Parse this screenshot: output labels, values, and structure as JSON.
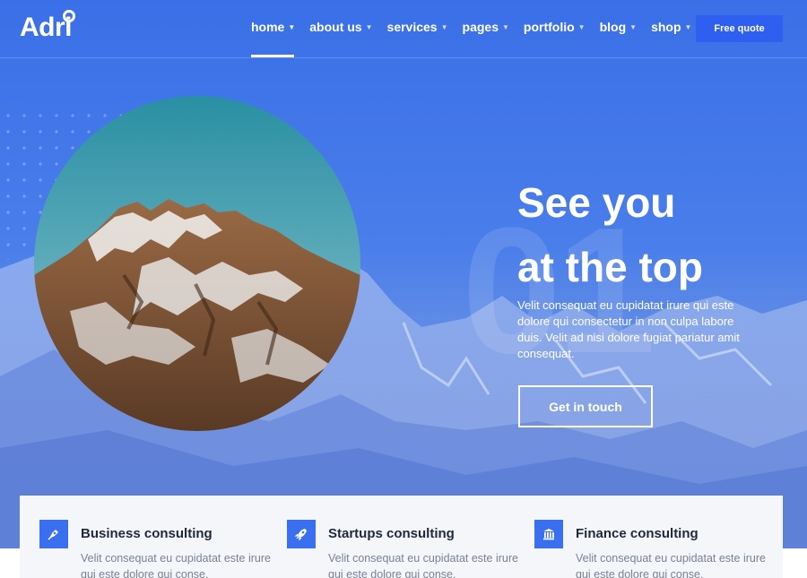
{
  "brand": {
    "logo_text": "Adri"
  },
  "nav": {
    "items": [
      {
        "label": "home",
        "active": true
      },
      {
        "label": "about us",
        "active": false
      },
      {
        "label": "services",
        "active": false
      },
      {
        "label": "pages",
        "active": false
      },
      {
        "label": "portfolio",
        "active": false
      },
      {
        "label": "blog",
        "active": false
      },
      {
        "label": "shop",
        "active": false
      }
    ],
    "cta_label": "Free quote"
  },
  "hero": {
    "background_number": "01",
    "headline_line1": "See you",
    "headline_line2": "at the top",
    "text": "Velit consequat eu cupidatat irure qui este dolore qui consectetur in non culpa labore duis. Velit ad nisi dolore fugiat pariatur amit consequat.",
    "button_label": "Get in touch"
  },
  "services": [
    {
      "icon": "pen-nib-icon",
      "title": "Business consulting",
      "text": "Velit consequat eu cupidatat este irure qui este dolore qui conse."
    },
    {
      "icon": "rocket-icon",
      "title": "Startups consulting",
      "text": "Velit consequat eu cupidatat este irure qui este dolore qui conse."
    },
    {
      "icon": "bank-icon",
      "title": "Finance consulting",
      "text": "Velit consequat eu cupidatat este irure qui este dolore qui conse."
    }
  ],
  "colors": {
    "primary": "#3a6ff0",
    "hero_blue": "#3a6fe8",
    "text_dark": "#1f2937",
    "text_muted": "#7a8292"
  }
}
